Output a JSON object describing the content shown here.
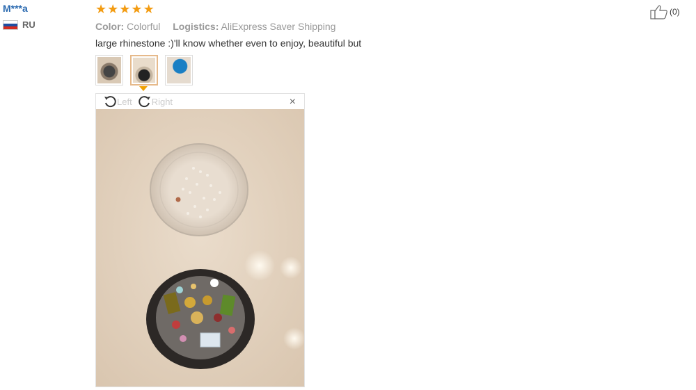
{
  "user": {
    "name": "M***a",
    "country_code": "RU",
    "flag_colors": [
      "#ffffff",
      "#1f4ea1",
      "#d52b1e"
    ]
  },
  "review": {
    "rating": 5,
    "color_label": "Color:",
    "color_value": "Colorful",
    "logistics_label": "Logistics:",
    "logistics_value": "AliExpress Saver Shipping",
    "text": "large rhinestone :)'ll know whether even to enjoy, beautiful but",
    "thumbnails": [
      "photo-1",
      "photo-2",
      "photo-3"
    ],
    "active_thumbnail": 1
  },
  "viewer": {
    "rotate_left_label": "Left",
    "rotate_right_label": "Right",
    "close_label": "×",
    "rotate_left_icon": "rotate-left-icon",
    "rotate_right_icon": "rotate-right-icon"
  },
  "helpful": {
    "count_text": "(0)",
    "icon": "thumbs-up-icon"
  },
  "colors": {
    "accent_star": "#f39c12",
    "username": "#2b6ab0",
    "active_thumb_border": "#e6b98a",
    "pointer": "#f0a000"
  }
}
